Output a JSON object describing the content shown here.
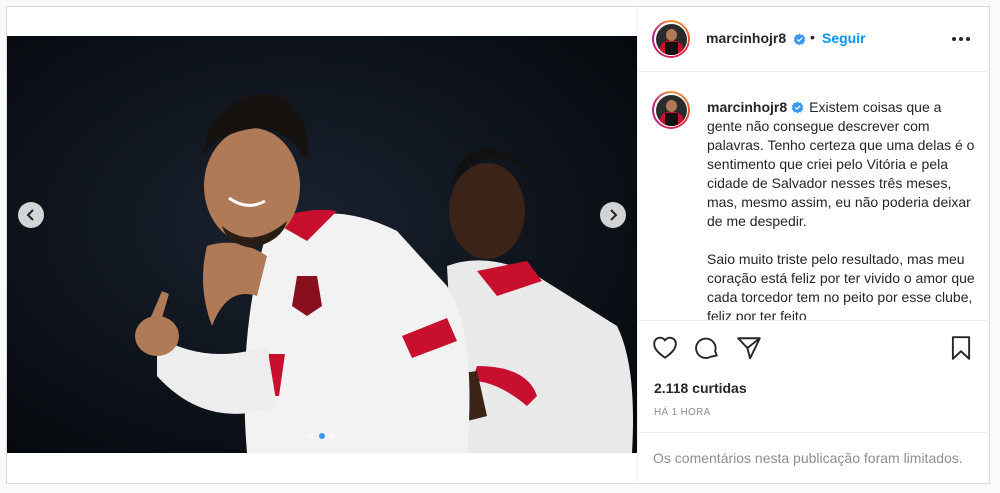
{
  "header": {
    "username": "marcinhojr8",
    "separator": "•",
    "follow_label": "Seguir"
  },
  "caption": {
    "username": "marcinhojr8",
    "paragraph_1": "Existem coisas que a gente não consegue descrever com palavras. Tenho certeza que uma delas é o sentimento que criei pelo Vitória e pela cidade de Salvador nesses três meses, mas, mesmo assim, eu não poderia deixar de me despedir.",
    "paragraph_2": "Saio muito triste pelo resultado, mas meu coração está feliz por ter vivido o amor que cada torcedor tem no peito por esse clube, feliz por ter feito"
  },
  "actions": {
    "likes": "2.118 curtidas",
    "time": "HÁ 1 HORA"
  },
  "comments": {
    "limited_text": "Os comentários nesta publicação foram limitados."
  },
  "carousel": {
    "total_slides": 3,
    "active_index": 1
  },
  "icons": {
    "verified": "verified-badge-icon",
    "like": "heart-icon",
    "comment": "comment-bubble-icon",
    "share": "paper-plane-icon",
    "save": "bookmark-icon",
    "more": "more-options-icon",
    "prev": "chevron-left-icon",
    "next": "chevron-right-icon"
  },
  "colors": {
    "link_blue": "#0095f6",
    "verified_blue": "#3897f0",
    "text": "#262626",
    "muted": "#8e8e8e",
    "jersey_red": "#c8102e"
  }
}
